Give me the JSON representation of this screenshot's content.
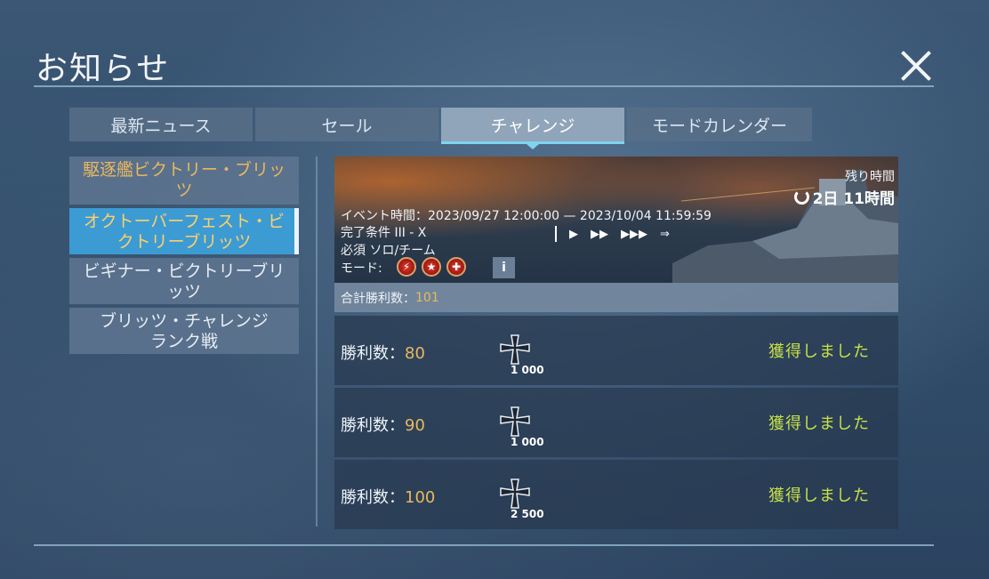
{
  "header": {
    "title": "お知らせ"
  },
  "tabs": [
    {
      "label": "最新ニュース"
    },
    {
      "label": "セール"
    },
    {
      "label": "チャレンジ"
    },
    {
      "label": "モードカレンダー"
    }
  ],
  "sidebar": {
    "items": [
      {
        "line1": "駆逐艦ビクトリー・ブリッ",
        "line2": "ツ"
      },
      {
        "line1": "オクトーバーフェスト・ビ",
        "line2": "クトリーブリッツ"
      },
      {
        "line1": "ビギナー・ビクトリーブリ",
        "line2": "ッツ"
      },
      {
        "line1": "ブリッツ・チャレンジ",
        "line2": "ランク戦"
      }
    ]
  },
  "banner": {
    "remaining_label": "残り時間",
    "remaining_value": "2日 11時間",
    "event_time": "イベント時間：2023/09/27  12:00:00  —  2023/10/04  11:59:59",
    "complete_cond": "完了条件   III - X",
    "required": "必須   ソロ/チーム",
    "mode_label": "モード:",
    "info": "i"
  },
  "total": {
    "label": "合計勝利数：",
    "value": "101"
  },
  "rewards": [
    {
      "label": "勝利数：",
      "wins": "80",
      "amount": "1 000",
      "status": "獲得しました"
    },
    {
      "label": "勝利数：",
      "wins": "90",
      "amount": "1 000",
      "status": "獲得しました"
    },
    {
      "label": "勝利数：",
      "wins": "100",
      "amount": "2 500",
      "status": "獲得しました"
    }
  ],
  "icons": {
    "close": "close-icon",
    "timer": "timer-icon",
    "reward": "iron-cross-icon"
  }
}
